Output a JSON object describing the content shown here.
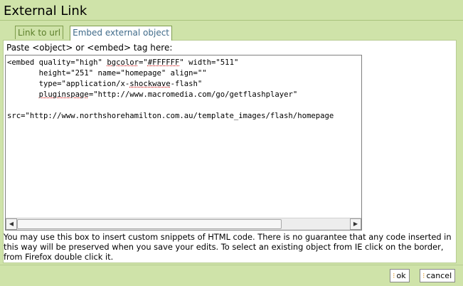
{
  "dialog": {
    "title": "External Link"
  },
  "tabs": [
    {
      "label": "Link to url",
      "active": false
    },
    {
      "label": "Embed external object",
      "active": true
    }
  ],
  "panel": {
    "label": "Paste <object> or <embed> tag here:",
    "code": {
      "line1_a": "<embed quality=\"high\" ",
      "line1_b": "bgcolor",
      "line1_c": "=\"",
      "line1_d": "#FFFFFF",
      "line1_e": "\" width=\"511\"",
      "line2": "       height=\"251\" name=\"homepage\" align=\"\"",
      "line3_a": "       type=\"application/x-",
      "line3_b": "shockwave",
      "line3_c": "-flash\"",
      "line4_a": "       ",
      "line4_b": "pluginspage",
      "line4_c": "=\"http://www.macromedia.com/go/getflashplayer\"",
      "line5": "",
      "line6": "src=\"http://www.northshorehamilton.com.au/template_images/flash/homepage"
    }
  },
  "help_text": "You may use this box to insert custom snippets of HTML code. There is no guarantee that any code inserted in this way will be preserved when you save your edits. To select an existing object from IE click on the border, from Firefox double click it.",
  "buttons": {
    "ok": {
      "label": "ok",
      "icon": "bullet-icon"
    },
    "cancel": {
      "label": "cancel",
      "icon": "bullet-icon"
    }
  },
  "colors": {
    "background": "#cfe3a9",
    "tab_text": "#5b7e2a",
    "active_tab_text": "#406b8a",
    "button_icon": "#e6a33a"
  }
}
